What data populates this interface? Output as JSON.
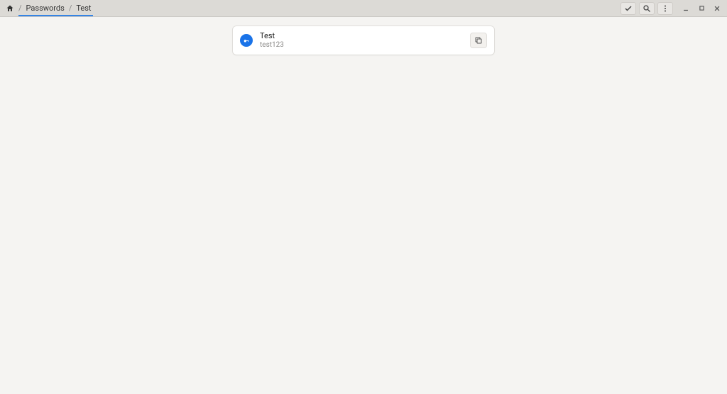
{
  "breadcrumb": {
    "home": "Home",
    "section": "Passwords",
    "current": "Test"
  },
  "entry": {
    "title": "Test",
    "username": "test123"
  }
}
